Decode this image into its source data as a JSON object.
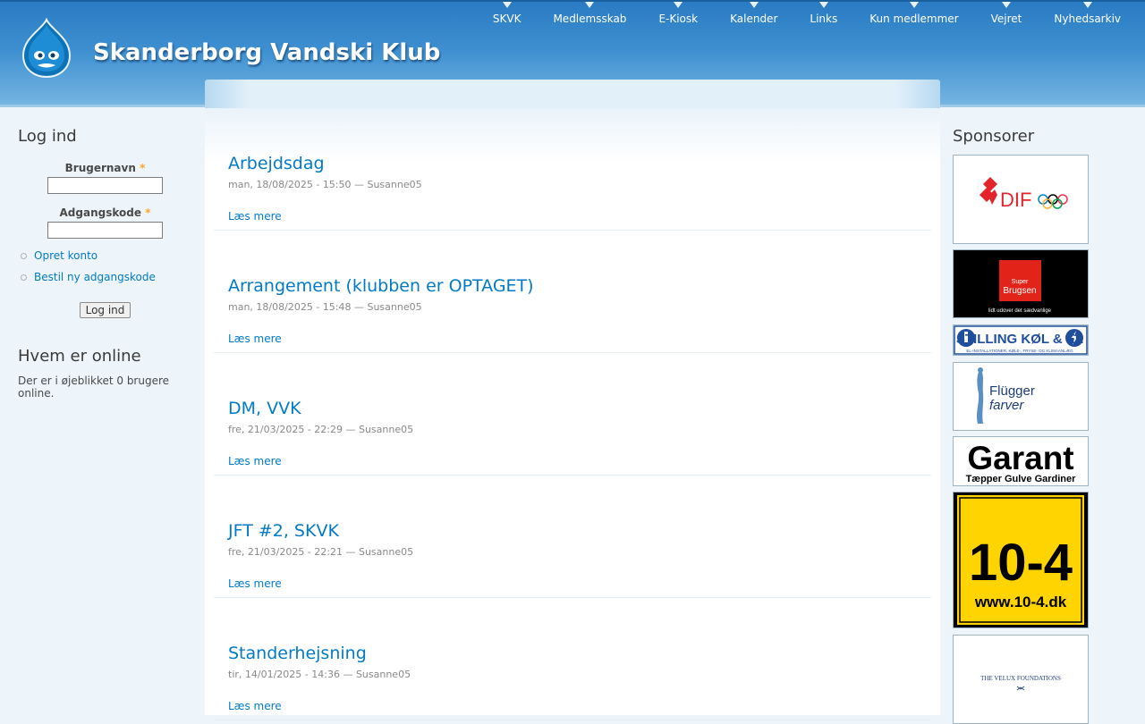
{
  "site": {
    "name": "Skanderborg Vandski Klub"
  },
  "nav": [
    "SKVK",
    "Medlemsskab",
    "E-Kiosk",
    "Kalender",
    "Links",
    "Kun medlemmer",
    "Vejret",
    "Nyhedsarkiv"
  ],
  "login": {
    "title": "Log ind",
    "username_label": "Brugernavn",
    "password_label": "Adgangskode",
    "required_mark": "*",
    "links": [
      "Opret konto",
      "Bestil ny adgangskode"
    ],
    "submit": "Log ind"
  },
  "online": {
    "title": "Hvem er online",
    "text": "Der er i øjeblikket 0 brugere online."
  },
  "sponsors": {
    "title": "Sponsorer",
    "dif": "DIF",
    "brugsen_small": "Super",
    "brugsen": "Brugsen",
    "brugsen_tagline": "lidt udover det sædvanlige",
    "stilling": "STILLING KØL & EL",
    "stilling_sub": "EL-INSTALLATIONER, KØLE-, FRYSE- OG KLIMAANLÆG",
    "flugger": "Flügger",
    "flugger_sub": "farver",
    "garant": "Garant",
    "garant_sub": "Tæpper Gulve Gardiner",
    "tenfour": "10-4",
    "tenfour_url": "www.10-4.dk",
    "velux": "THE VELUX FOUNDATIONS"
  },
  "nodes": [
    {
      "title": "Arbejdsdag",
      "meta": "man, 18/08/2025 - 15:50 — Susanne05",
      "more": "Læs mere"
    },
    {
      "title": "Arrangement (klubben er OPTAGET)",
      "meta": "man, 18/08/2025 - 15:48 — Susanne05",
      "more": "Læs mere"
    },
    {
      "title": "DM, VVK",
      "meta": "fre, 21/03/2025 - 22:29 — Susanne05",
      "more": "Læs mere"
    },
    {
      "title": "JFT #2, SKVK",
      "meta": "fre, 21/03/2025 - 22:21 — Susanne05",
      "more": "Læs mere"
    },
    {
      "title": "Standerhejsning",
      "meta": "tir, 14/01/2025 - 14:36 — Susanne05",
      "more": "Læs mere"
    }
  ],
  "colors": {
    "link": "#027ac6",
    "header_top": "#2a7bc3",
    "header_bottom": "#78b6e2",
    "page_bg": "#edf5fa"
  }
}
